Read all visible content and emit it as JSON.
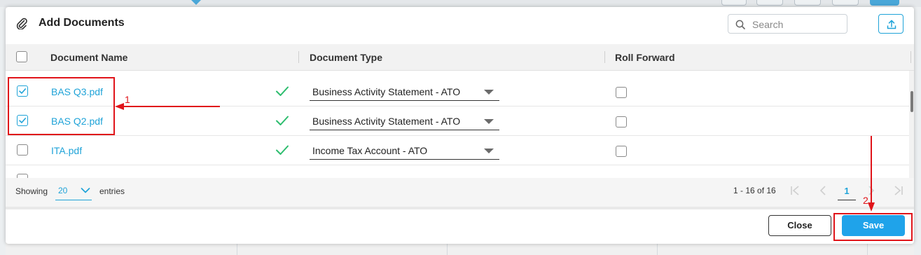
{
  "dialog": {
    "title": "Add Documents",
    "search_placeholder": "Search",
    "upload_icon": "upload-icon"
  },
  "table": {
    "headers": [
      "Document Name",
      "Document Type",
      "Roll Forward"
    ],
    "rows": [
      {
        "name": "BAS Q3.pdf",
        "type": "Business Activity Statement - ATO",
        "selected": true,
        "roll_forward": false
      },
      {
        "name": "BAS Q2.pdf",
        "type": "Business Activity Statement - ATO",
        "selected": true,
        "roll_forward": false
      },
      {
        "name": "ITA.pdf",
        "type": "Income Tax Account - ATO",
        "selected": false,
        "roll_forward": false
      }
    ]
  },
  "footer": {
    "showing_label": "Showing",
    "page_size": "20",
    "entries_label": "entries",
    "range_text": "1 - 16 of 16",
    "current_page": "1"
  },
  "buttons": {
    "close": "Close",
    "save": "Save"
  },
  "annotations": {
    "label_1": "1",
    "label_2": "2",
    "color": "#e0141a"
  },
  "colors": {
    "accent": "#1fa3d8",
    "save": "#1fa3ea",
    "check_ok": "#2dbd6e"
  }
}
